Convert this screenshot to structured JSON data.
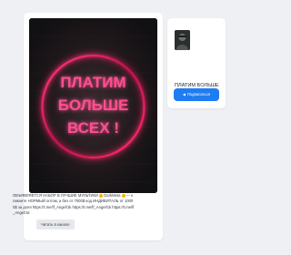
{
  "post": {
    "image": {
      "neon_line_1": "ПЛАТИМ",
      "neon_line_2": "БОЛЬШЕ",
      "neon_line_3": "ВСЕХ !",
      "text_color": "#ff3f86",
      "ring_color": "#b81c4d"
    },
    "text": "ОБЪЯВЛЯЕТСЯ НАБОР В ЛУЧШИЕ МУЛЬТИКИ [emoji] DarkMeta [emoji] — кликните НОРМЫЙ оптом, и без от 7000$ код ИНДИВИТАЛЬ от 10000$ за доля https://t.me/lf_Angel/1k https://t.me/lf_Angel/1k https://t.me/lf_Angel/1k",
    "text_parts": [
      "ОБЪЯВЛЯЕТСЯ НАБОР В ЛУЧШИЕ МУЛЬТИКИ ",
      " DarkMeta ",
      " — кликните НОРМЫЙ оптом, и без от 7000$ код ИНДИВИТАЛЬ от 10000$ за доля https://t.me/lf_Angel/1k https://t.me/lf_Angel/1k https://t.me/lf_Angel/1k"
    ],
    "button_label": "Читать в канале"
  },
  "channel": {
    "title": "ПЛАТИМ БОЛЬШЕ ВСЕХ !",
    "subscribe_label": "Подписаться",
    "accent_color": "#1f7cf2"
  }
}
